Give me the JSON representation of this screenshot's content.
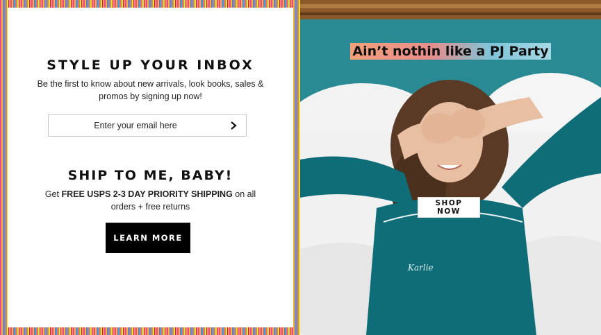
{
  "newsletter": {
    "heading": "STYLE UP YOUR INBOX",
    "description": "Be the first to know about new arrivals, look books, sales & promos by signing up now!",
    "email_placeholder": "Enter your email here",
    "submit_icon": "chevron-right-icon"
  },
  "shipping": {
    "heading": "SHIP TO ME, BABY!",
    "text_prefix": "Get ",
    "text_bold": "FREE USPS 2-3 DAY PRIORITY SHIPPING",
    "text_suffix": " on all orders + free returns",
    "button_label": "LEARN MORE"
  },
  "promo": {
    "title": "Ain’t nothin like a PJ Party",
    "button_label": "SHOP NOW",
    "pajama_script": "Karlie"
  },
  "colors": {
    "accent_black": "#000000",
    "photo_teal": "#2a8a94",
    "pajama_teal": "#0f6d78"
  }
}
